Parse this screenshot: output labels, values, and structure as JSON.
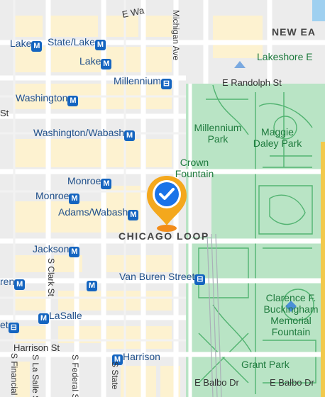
{
  "map": {
    "neighborhood": "CHICAGO LOOP",
    "streets": {
      "randolph": "E Randolph St",
      "van_buren": "Van Buren Street",
      "harrison": "Harrison St",
      "balbo_w": "E Balbo Dr",
      "balbo_e": "E Balbo Dr",
      "ewa": "E Wa",
      "michigan": "Michigan Ave",
      "clark": "S Clark St",
      "lasalle": "S La Salle St",
      "federal": "S Federal St",
      "state": "S State",
      "financial": "S Financial"
    },
    "stations": {
      "state_lake": "State/Lake",
      "lake_left": "Lake",
      "lake": "Lake",
      "millennium": "Millennium",
      "washington": "Washington",
      "washington_wabash": "Washington/Wabash",
      "monroe_1": "Monroe",
      "monroe_2": "Monroe",
      "adams_wabash": "Adams/Wabash",
      "jackson": "Jackson",
      "lasalle": "LaSalle",
      "harrison": "Harrison",
      "ren": "ren",
      "et": "et",
      "st": "St"
    },
    "parks": {
      "millennium_park": "Millennium Park",
      "maggie_daley": "Maggie Daley Park",
      "crown_fountain": "Crown Fountain",
      "buckingham": "Clarence F. Buckingham Memorial Fountain",
      "grant_park": "Grant Park"
    },
    "places": {
      "new_eastside": "NEW EA",
      "lakeshore": "Lakeshore E"
    },
    "badge_glyph": "M",
    "train_glyph": "⊟",
    "colors": {
      "park": "#b9e4c5",
      "park_path": "#52b371",
      "block": "#fdf2d0",
      "water": "#9fd0f0",
      "pin": "#f4a81d",
      "pin_check": "#1a73e8",
      "transit": "#1565c0"
    }
  }
}
